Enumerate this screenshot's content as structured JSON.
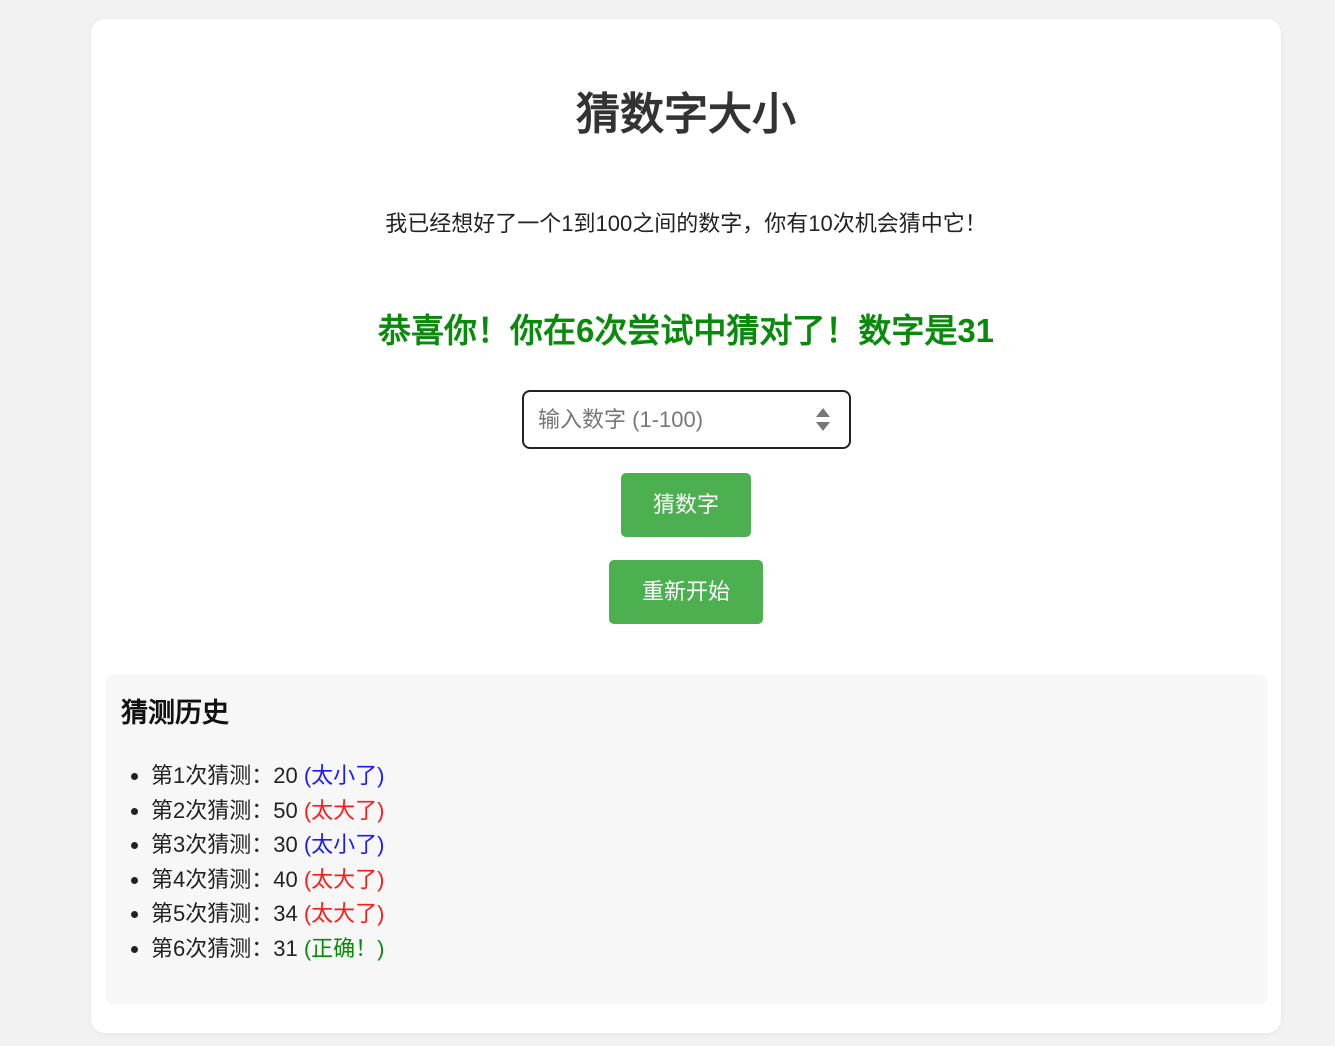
{
  "page": {
    "title": "猜数字大小",
    "intro": "我已经想好了一个1到100之间的数字，你有10次机会猜中它！",
    "result_message": "恭喜你！你在6次尝试中猜对了！数字是31"
  },
  "input": {
    "placeholder": "输入数字 (1-100)",
    "value": ""
  },
  "buttons": {
    "guess_label": "猜数字",
    "restart_label": "重新开始"
  },
  "history": {
    "title": "猜测历史",
    "items": [
      {
        "prefix": "第1次猜测：20 ",
        "result": "(太小了)",
        "status": "low"
      },
      {
        "prefix": "第2次猜测：50 ",
        "result": "(太大了)",
        "status": "high"
      },
      {
        "prefix": "第3次猜测：30 ",
        "result": "(太小了)",
        "status": "low"
      },
      {
        "prefix": "第4次猜测：40 ",
        "result": "(太大了)",
        "status": "high"
      },
      {
        "prefix": "第5次猜测：34 ",
        "result": "(太大了)",
        "status": "high"
      },
      {
        "prefix": "第6次猜测：31 ",
        "result": "(正确！)",
        "status": "correct"
      }
    ]
  },
  "colors": {
    "accent": "#4caf50",
    "success": "#0a8a0a",
    "too_low": "#1a1aff",
    "too_high": "#ff1a1a"
  }
}
